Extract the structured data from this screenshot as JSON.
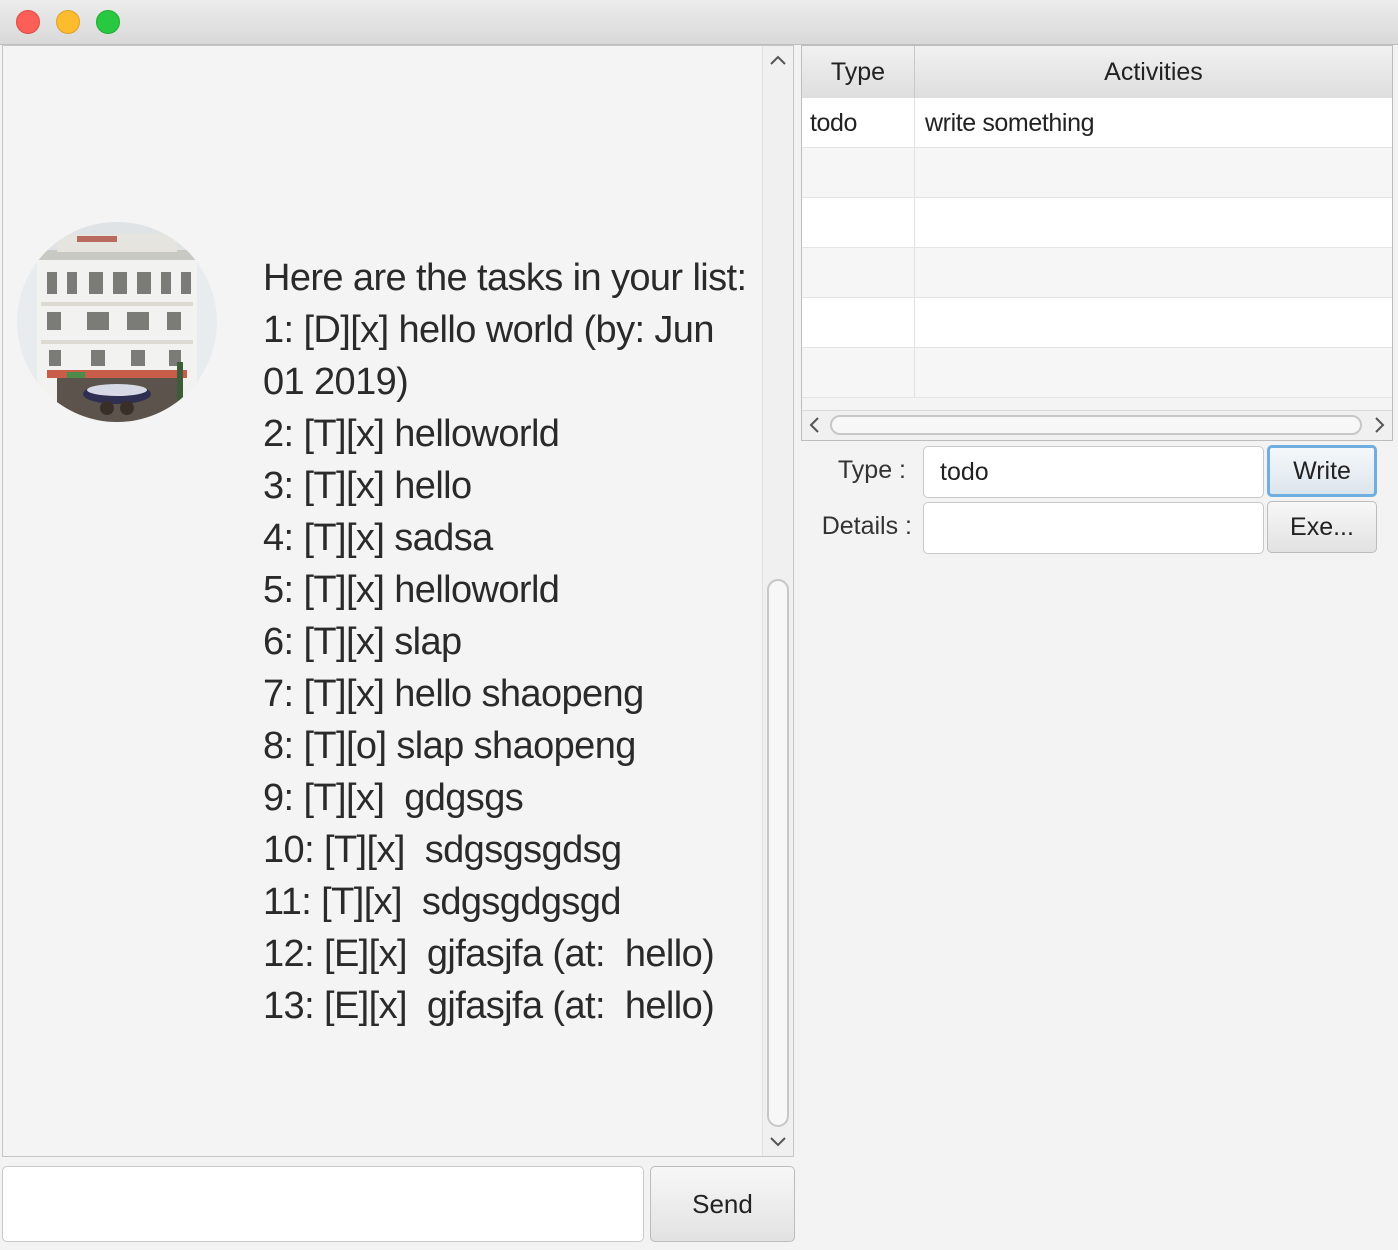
{
  "window": {
    "controls": [
      "close",
      "minimize",
      "maximize"
    ]
  },
  "dialog": {
    "lines": [
      "Here are the tasks in your list:",
      "1: [D][x] hello world (by: Jun 01 2019)",
      "2: [T][x] helloworld",
      "3: [T][x] hello",
      "4: [T][x] sadsa",
      "5: [T][x] helloworld",
      "6: [T][x] slap",
      "7: [T][x] hello shaopeng",
      "8: [T][o] slap shaopeng",
      "9: [T][x]  gdgsgs",
      "10: [T][x]  sdgsgsgdsg",
      "11: [T][x]  sdgsgdgsgd",
      "12: [E][x]  gjfasjfa (at:  hello)",
      "13: [E][x]  gjfasjfa (at:  hello)"
    ]
  },
  "input": {
    "value": "",
    "placeholder": ""
  },
  "send_label": "Send",
  "table": {
    "headers": {
      "type": "Type",
      "activities": "Activities"
    },
    "rows": [
      {
        "type": "todo",
        "activity": "write something"
      }
    ]
  },
  "form": {
    "type_label": "Type :",
    "type_value": "todo",
    "details_label": "Details :",
    "details_value": "",
    "write_label": "Write",
    "execute_label": "Exe..."
  },
  "icons": {
    "scroll_up": "chevron-up-icon",
    "scroll_down": "chevron-down-icon",
    "scroll_left": "chevron-left-icon",
    "scroll_right": "chevron-right-icon"
  },
  "colors": {
    "close": "#fc5f57",
    "minimize": "#fdbc2e",
    "maximize": "#28c840",
    "focus_ring": "#6eaee0"
  }
}
